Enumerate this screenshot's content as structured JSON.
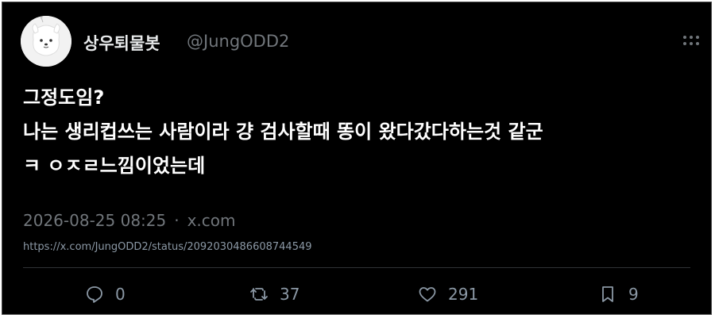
{
  "author": {
    "display_name": "상우퇴물봇",
    "handle": "@JungODD2",
    "avatar_icon": "white-dog-avatar"
  },
  "tweet": {
    "lines": [
      "그정도임?",
      "나는 생리컵쓰는 사람이라 걍 검사할때 똥이 왔다갔다하는것 같군",
      "ㅋ ㅇㅈㄹ느낌이었는데"
    ],
    "timestamp": "2026-08-25 08:25",
    "separator": "·",
    "source": "x.com",
    "url": "https://x.com/JungODD2/status/2092030486608744549"
  },
  "actions": {
    "replies": "0",
    "retweets": "37",
    "likes": "291",
    "bookmarks": "9"
  },
  "colors": {
    "background": "#000000",
    "text": "#e7e9ea",
    "muted": "#71767b"
  }
}
